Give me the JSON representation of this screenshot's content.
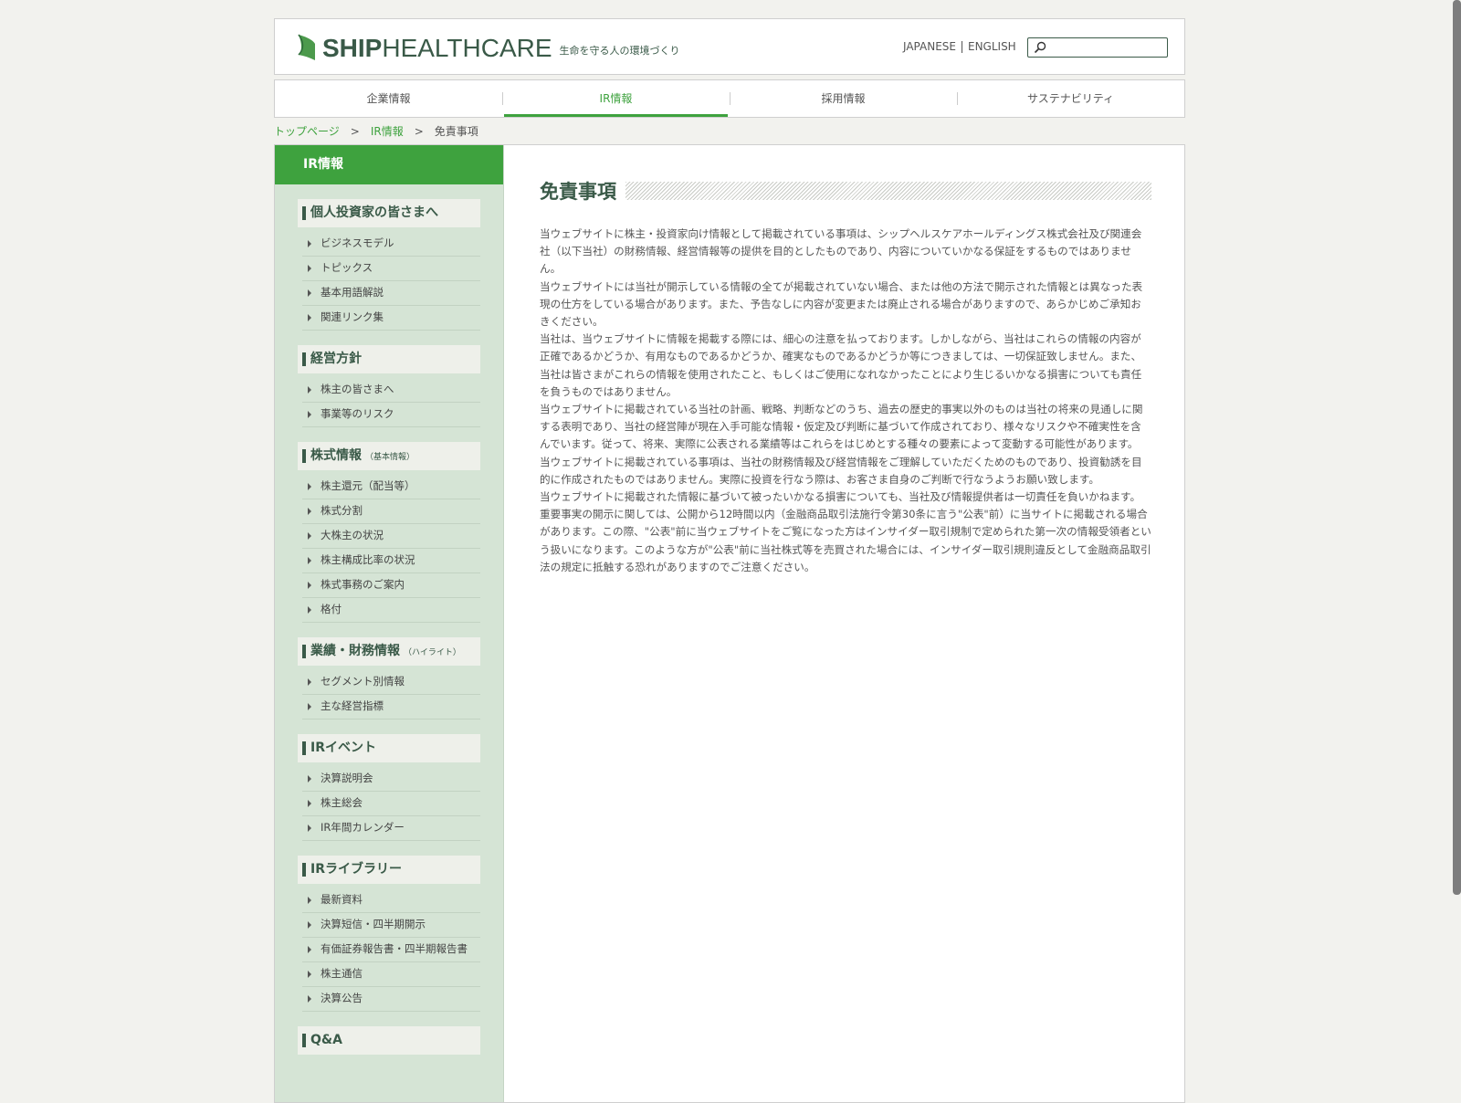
{
  "header": {
    "logo_bold": "SHIP",
    "logo_light": "HEALTHCARE",
    "tagline": "生命を守る人の環境づくり",
    "lang_japanese": "JAPANESE",
    "lang_english": "ENGLISH",
    "search_placeholder": ""
  },
  "nav": {
    "items": [
      {
        "label": "企業情報"
      },
      {
        "label": "IR情報"
      },
      {
        "label": "採用情報"
      },
      {
        "label": "サステナビリティ"
      }
    ]
  },
  "breadcrumb": {
    "home": "トップページ",
    "ir": "IR情報",
    "current": "免責事項",
    "sep": ">"
  },
  "sidebar": {
    "head": "IR情報",
    "sections": [
      {
        "title": "個人投資家の皆さまへ",
        "note": "",
        "items": [
          "ビジネスモデル",
          "トピックス",
          "基本用語解説",
          "関連リンク集"
        ]
      },
      {
        "title": "経営方針",
        "note": "",
        "items": [
          "株主の皆さまへ",
          "事業等のリスク"
        ]
      },
      {
        "title": "株式情報",
        "note": "（基本情報）",
        "items": [
          "株主還元（配当等）",
          "株式分割",
          "大株主の状況",
          "株主構成比率の状況",
          "株式事務のご案内",
          "格付"
        ]
      },
      {
        "title": "業績・財務情報",
        "note": "（ハイライト）",
        "items": [
          "セグメント別情報",
          "主な経営指標"
        ]
      },
      {
        "title": "IRイベント",
        "note": "",
        "items": [
          "決算説明会",
          "株主総会",
          "IR年間カレンダー"
        ]
      },
      {
        "title": "IRライブラリー",
        "note": "",
        "items": [
          "最新資料",
          "決算短信・四半期開示",
          "有価証券報告書・四半期報告書",
          "株主通信",
          "決算公告"
        ]
      },
      {
        "title": "Q&A",
        "note": "",
        "items": []
      }
    ]
  },
  "content": {
    "title": "免責事項",
    "paragraphs": [
      "当ウェブサイトに株主・投資家向け情報として掲載されている事項は、シップヘルスケアホールディングス株式会社及び関連会社（以下当社）の財務情報、経営情報等の提供を目的としたものであり、内容についていかなる保証をするものではありません。",
      "当ウェブサイトには当社が開示している情報の全てが掲載されていない場合、または他の方法で開示された情報とは異なった表現の仕方をしている場合があります。また、予告なしに内容が変更または廃止される場合がありますので、あらかじめご承知おきください。",
      "当社は、当ウェブサイトに情報を掲載する際には、細心の注意を払っております。しかしながら、当社はこれらの情報の内容が正確であるかどうか、有用なものであるかどうか、確実なものであるかどうか等につきましては、一切保証致しません。また、当社は皆さまがこれらの情報を使用されたこと、もしくはご使用になれなかったことにより生じるいかなる損害についても責任を負うものではありません。",
      "当ウェブサイトに掲載されている当社の計画、戦略、判断などのうち、過去の歴史的事実以外のものは当社の将来の見通しに関する表明であり、当社の経営陣が現在入手可能な情報・仮定及び判断に基づいて作成されており、様々なリスクや不確実性を含んでいます。従って、将来、実際に公表される業績等はこれらをはじめとする種々の要素によって変動する可能性があります。",
      "当ウェブサイトに掲載されている事項は、当社の財務情報及び経営情報をご理解していただくためのものであり、投資勧誘を目的に作成されたものではありません。実際に投資を行なう際は、お客さま自身のご判断で行なうようお願い致します。",
      "当ウェブサイトに掲載された情報に基づいて被ったいかなる損害についても、当社及び情報提供者は一切責任を負いかねます。",
      "重要事実の開示に関しては、公開から12時間以内（金融商品取引法施行令第30条に言う\"公表\"前）に当サイトに掲載される場合があります。この際、\"公表\"前に当ウェブサイトをご覧になった方はインサイダー取引規制で定められた第一次の情報受領者という扱いになります。このような方が\"公表\"前に当社株式等を売買された場合には、インサイダー取引規則違反として金融商品取引法の規定に抵触する恐れがありますのでご注意ください。"
    ]
  }
}
